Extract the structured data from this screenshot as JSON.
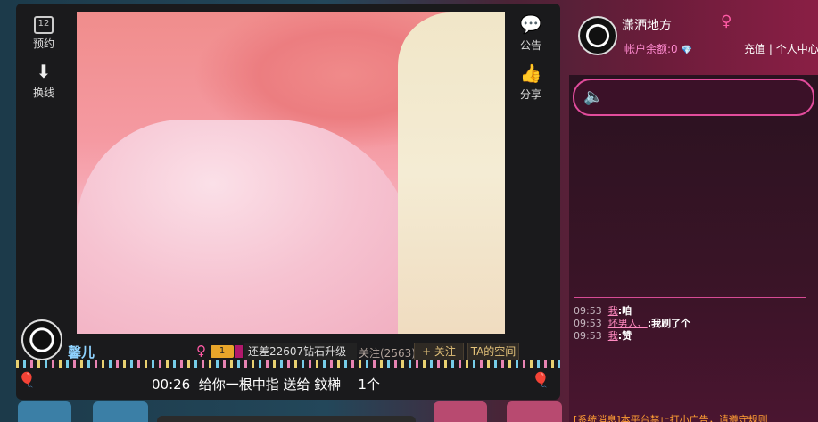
{
  "left_toolbar": {
    "reserve_label": "预约",
    "calendar_day": "12",
    "switch_label": "换线"
  },
  "right_toolbar": {
    "notice_label": "公告",
    "share_label": "分享"
  },
  "anchor": {
    "name": "馨儿",
    "level": "1",
    "upgrade_text": "还差22607钻石升级",
    "follow_count": "关注(2563)",
    "follow_button": "+ 关注",
    "space_button": "TA的空间"
  },
  "gift_ticker": "00:26  给你一根中指 送给 鈫榊    1个",
  "profile": {
    "name": "潇洒地方",
    "balance_label": "帐户余额:0",
    "recharge": "充值",
    "divider": "|",
    "personal_center": "个人中心"
  },
  "chat": {
    "messages": [
      {
        "time": "09:53",
        "user": "我",
        "sep": ":",
        "content": "咱"
      },
      {
        "time": "09:53",
        "user": "坏男人、",
        "sep": ":",
        "content": "我刷了个"
      },
      {
        "time": "09:53",
        "user": "我",
        "sep": ":",
        "content": "赞"
      }
    ],
    "system_line": "[系统消息]本平台禁止打小广告，请遵守规则"
  },
  "colors": {
    "accent_pink": "#e24c9c",
    "anchor_name": "#8fd3ff",
    "gold": "#e3c27a"
  }
}
